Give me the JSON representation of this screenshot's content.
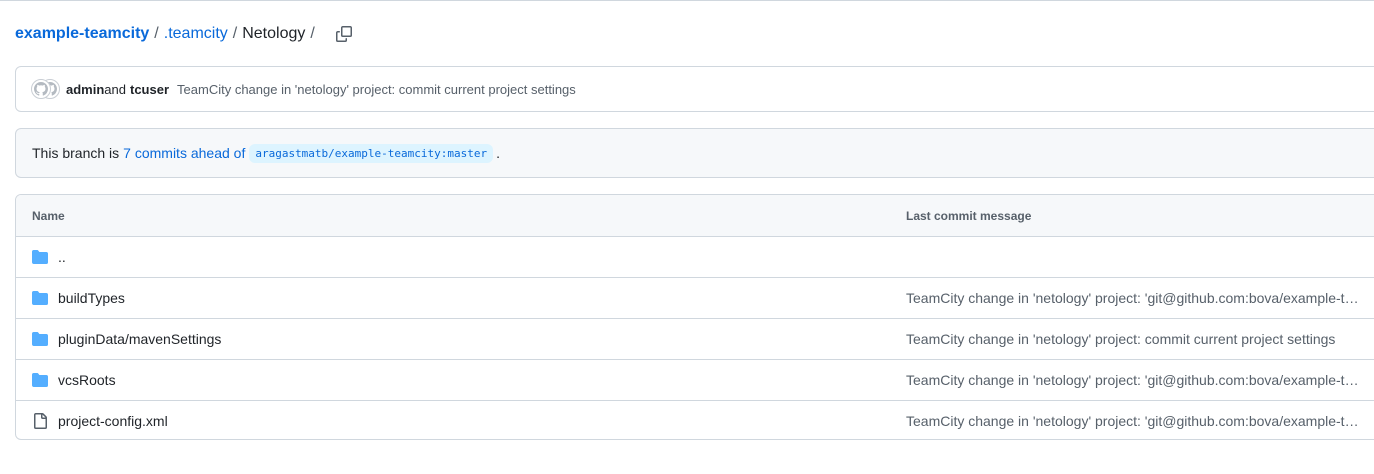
{
  "breadcrumb": {
    "repo": "example-teamcity",
    "sep1": "/",
    "folder": ".teamcity",
    "sep2": "/",
    "current": "Netology",
    "sep3": "/"
  },
  "commit": {
    "author1": "admin",
    "and_text": "and",
    "author2": "tcuser",
    "message": "TeamCity change in 'netology' project: commit current project settings"
  },
  "branch": {
    "prefix": "This branch is",
    "ahead_link": "7 commits ahead of",
    "base_ref": "aragastmatb/example-teamcity:master",
    "suffix": "."
  },
  "files": {
    "header_name": "Name",
    "header_message": "Last commit message",
    "rows": [
      {
        "name": "..",
        "type": "folder",
        "message": ""
      },
      {
        "name": "buildTypes",
        "type": "folder",
        "message": "TeamCity change in 'netology' project: 'git@github.com:bova/example-teamcity.git'"
      },
      {
        "name": "pluginData/mavenSettings",
        "type": "folder",
        "message": "TeamCity change in 'netology' project: commit current project settings"
      },
      {
        "name": "vcsRoots",
        "type": "folder",
        "message": "TeamCity change in 'netology' project: 'git@github.com:bova/example-teamcity.git'"
      },
      {
        "name": "project-config.xml",
        "type": "file",
        "message": "TeamCity change in 'netology' project: 'git@github.com:bova/example-teamcity.git'"
      }
    ]
  },
  "icons": {
    "copy": "copy-icon",
    "folder": "folder-icon",
    "file": "file-icon",
    "avatar": "avatar-icon"
  },
  "colors": {
    "link": "#0969da",
    "folder": "#54aeff",
    "muted": "#57606a",
    "border": "#d0d7de",
    "subtle_bg": "#f6f8fa"
  }
}
